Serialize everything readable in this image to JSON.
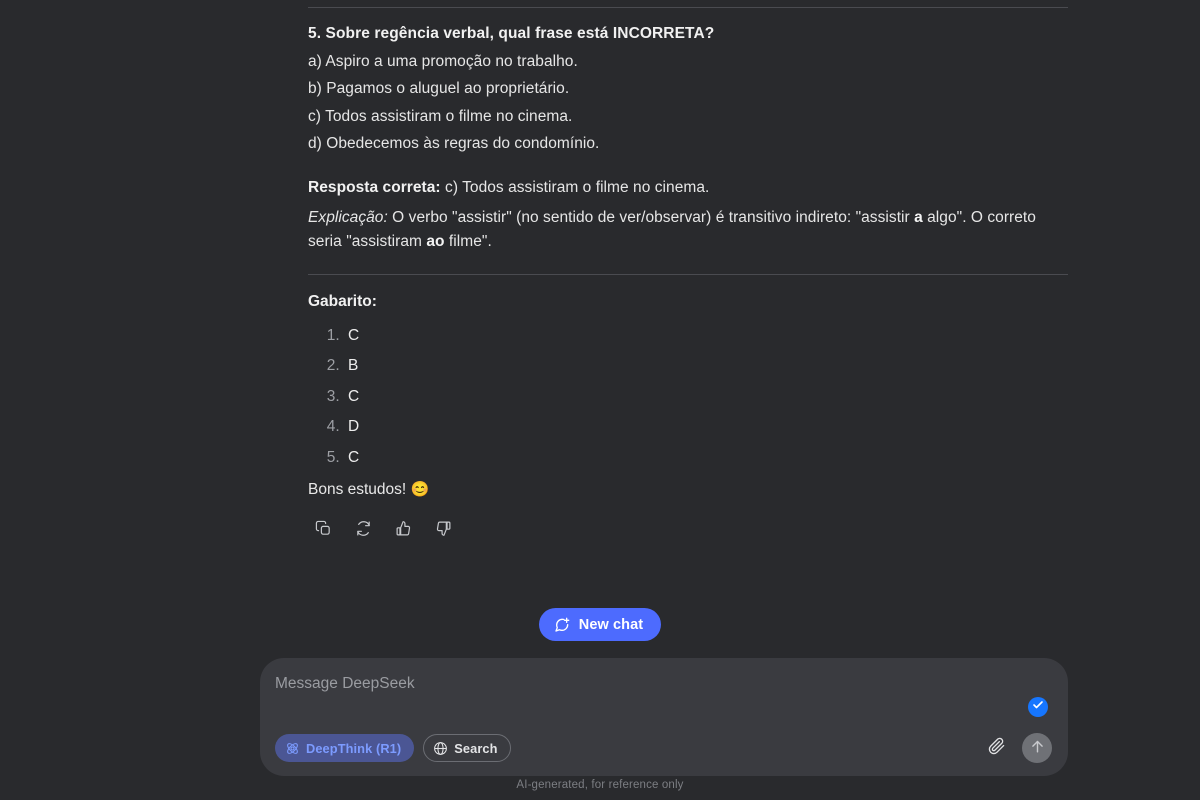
{
  "message": {
    "question_number": "5.",
    "question_title": "5. Sobre regência verbal, qual frase está INCORRETA?",
    "options": [
      "a) Aspiro a uma promoção no trabalho.",
      "b) Pagamos o aluguel ao proprietário.",
      "c) Todos assistiram o filme no cinema.",
      "d) Obedecemos às regras do condomínio."
    ],
    "answer": {
      "label": "Resposta correta:",
      "text": " c) Todos assistiram o filme no cinema."
    },
    "explanation": {
      "label": "Explicação:",
      "part1": " O verbo \"assistir\" (no sentido de ver/observar) é transitivo indireto: \"assistir ",
      "bold1": "a",
      "part2": " algo\". O correto seria \"assistiram ",
      "bold2": "ao",
      "part3": " filme\"."
    },
    "gabarito": {
      "title": "Gabarito:",
      "items": [
        "C",
        "B",
        "C",
        "D",
        "C"
      ]
    },
    "closing": "Bons estudos!",
    "closing_emoji": "😊"
  },
  "actions": [
    {
      "name": "copy",
      "label": "Copy"
    },
    {
      "name": "regenerate",
      "label": "Regenerate"
    },
    {
      "name": "like",
      "label": "Like"
    },
    {
      "name": "dislike",
      "label": "Dislike"
    }
  ],
  "new_chat": {
    "label": "New chat",
    "color": "#4d6bfe"
  },
  "composer": {
    "placeholder": "Message DeepSeek",
    "tools": [
      {
        "name": "deepthink",
        "label": "DeepThink (R1)",
        "active": true,
        "color": "#7c9bff"
      },
      {
        "name": "search",
        "label": "Search",
        "active": false
      }
    ],
    "background": "#3a3b40"
  },
  "footer": {
    "text": "AI-generated, for reference only"
  },
  "theme": {
    "background": "#292a2d",
    "text": "#e8e8e8",
    "muted": "#9d9fa4",
    "divider": "#4a4b50",
    "accent": "#4d6bfe",
    "badge": "#1676ff"
  }
}
